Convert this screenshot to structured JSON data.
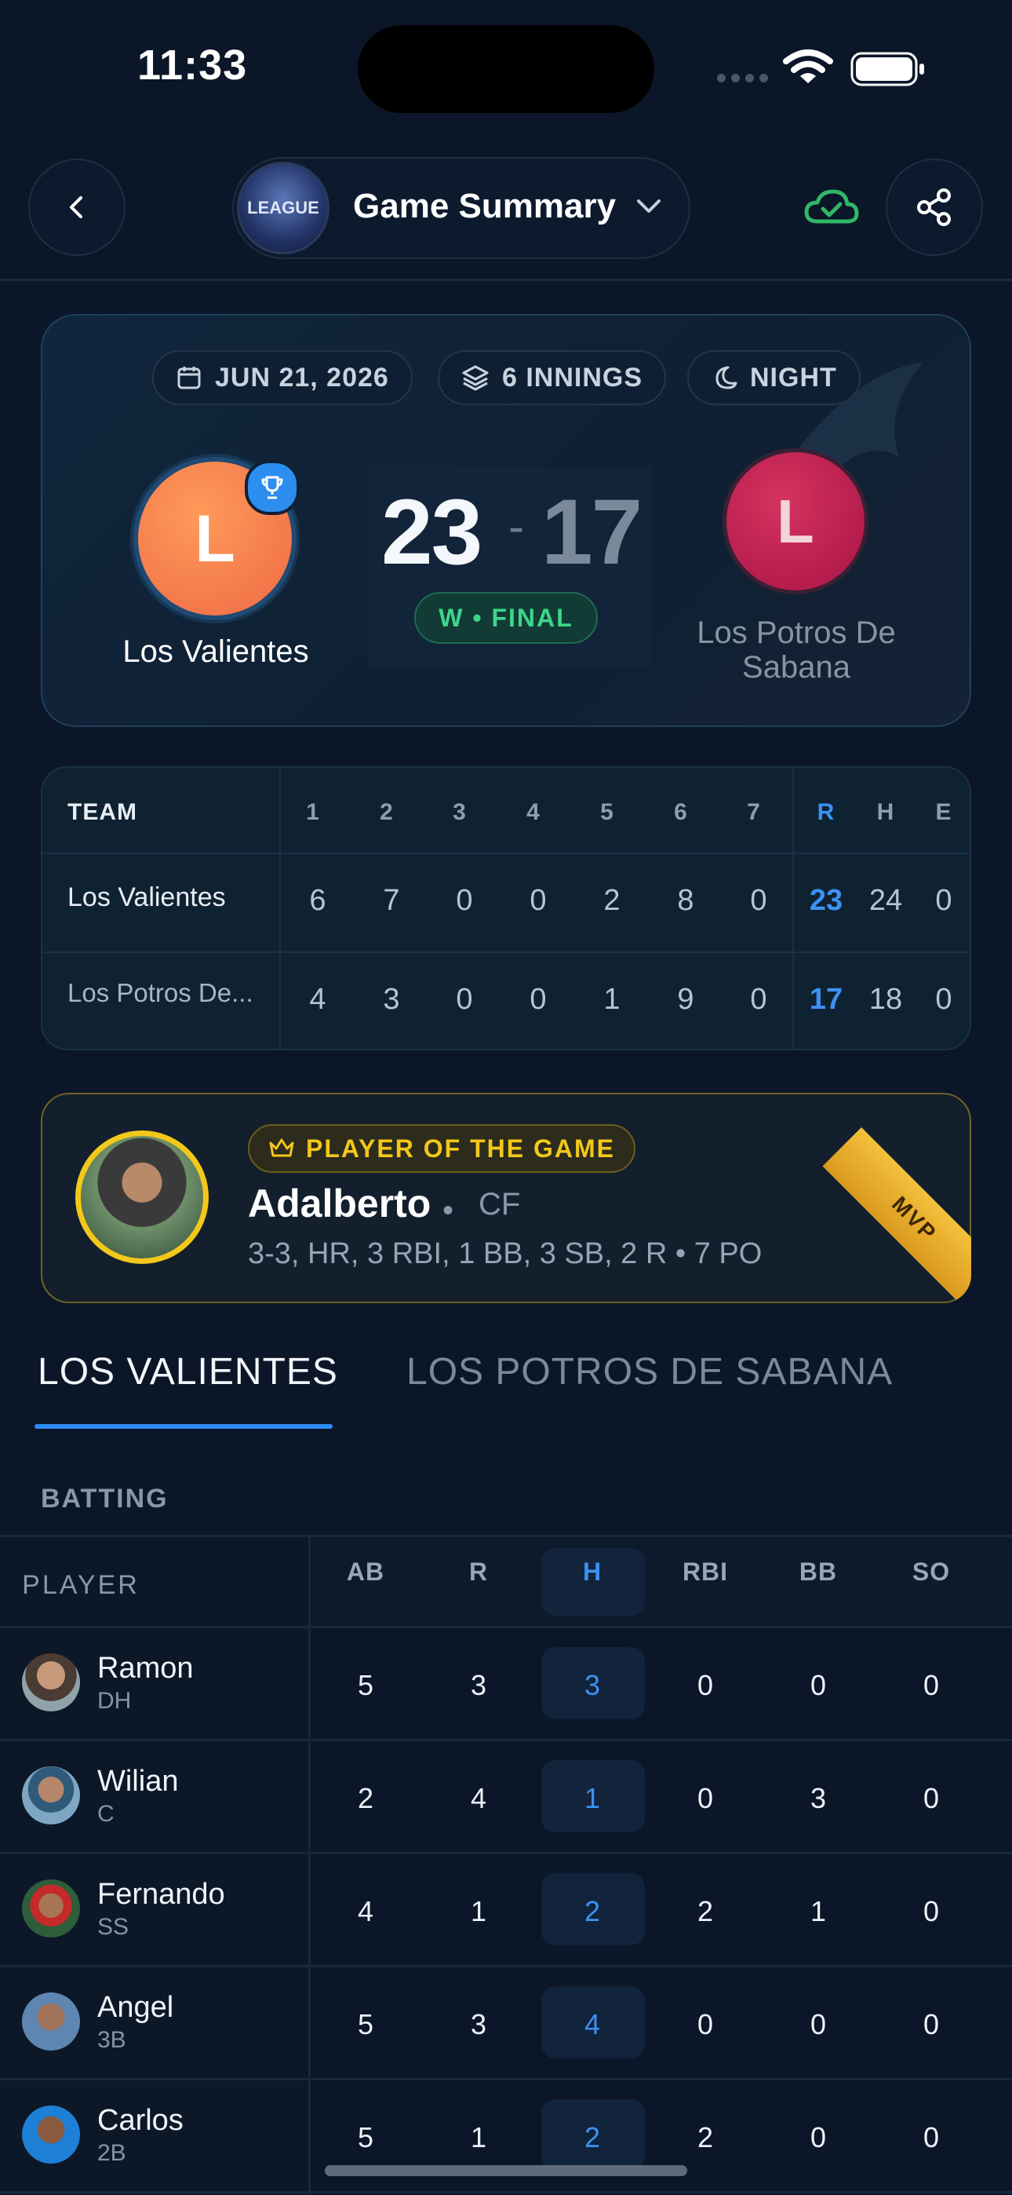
{
  "status_bar": {
    "time": "11:33"
  },
  "header": {
    "title": "Game Summary",
    "logo_text": "LEAGUE"
  },
  "game": {
    "date": "JUN 21, 2026",
    "innings": "6 INNINGS",
    "time_of_day": "NIGHT",
    "home": {
      "initial": "L",
      "name": "Los Valientes",
      "score": "23"
    },
    "away": {
      "initial": "L",
      "name": "Los Potros De Sabana",
      "score": "17"
    },
    "separator": "-",
    "result": "W • FINAL"
  },
  "linescore": {
    "team_header": "TEAM",
    "innings": [
      "1",
      "2",
      "3",
      "4",
      "5",
      "6",
      "7"
    ],
    "totals_headers": [
      "R",
      "H",
      "E"
    ],
    "rows": [
      {
        "team": "Los Valientes",
        "innings": [
          "6",
          "7",
          "0",
          "0",
          "2",
          "8",
          "0"
        ],
        "R": "23",
        "H": "24",
        "E": "0"
      },
      {
        "team": "Los Potros De...",
        "innings": [
          "4",
          "3",
          "0",
          "0",
          "1",
          "9",
          "0"
        ],
        "R": "17",
        "H": "18",
        "E": "0"
      }
    ]
  },
  "player_of_game": {
    "badge": "PLAYER OF THE GAME",
    "name": "Adalberto",
    "dot": "•",
    "position": "CF",
    "stats": "3-3, HR, 3 RBI, 1 BB, 3 SB, 2 R • 7 PO",
    "ribbon": "MVP"
  },
  "tabs": [
    "LOS VALIENTES",
    "LOS POTROS DE SABANA"
  ],
  "batting": {
    "section_label": "BATTING",
    "columns": [
      "PLAYER",
      "AB",
      "R",
      "H",
      "RBI",
      "BB",
      "SO"
    ],
    "rows": [
      {
        "name": "Ramon",
        "pos": "DH",
        "AB": "5",
        "R": "3",
        "H": "3",
        "RBI": "0",
        "BB": "0",
        "SO": "0"
      },
      {
        "name": "Wilian",
        "pos": "C",
        "AB": "2",
        "R": "4",
        "H": "1",
        "RBI": "0",
        "BB": "3",
        "SO": "0"
      },
      {
        "name": "Fernando",
        "pos": "SS",
        "AB": "4",
        "R": "1",
        "H": "2",
        "RBI": "2",
        "BB": "1",
        "SO": "0"
      },
      {
        "name": "Angel",
        "pos": "3B",
        "AB": "5",
        "R": "3",
        "H": "4",
        "RBI": "0",
        "BB": "0",
        "SO": "0"
      },
      {
        "name": "Carlos",
        "pos": "2B",
        "AB": "5",
        "R": "1",
        "H": "2",
        "RBI": "2",
        "BB": "0",
        "SO": "0"
      }
    ]
  },
  "colors": {
    "accent": "#2f8af0",
    "win_green": "#3ed68b",
    "gold": "#f2c81a",
    "home_team": "#ee6a45",
    "away_team": "#a81446"
  }
}
